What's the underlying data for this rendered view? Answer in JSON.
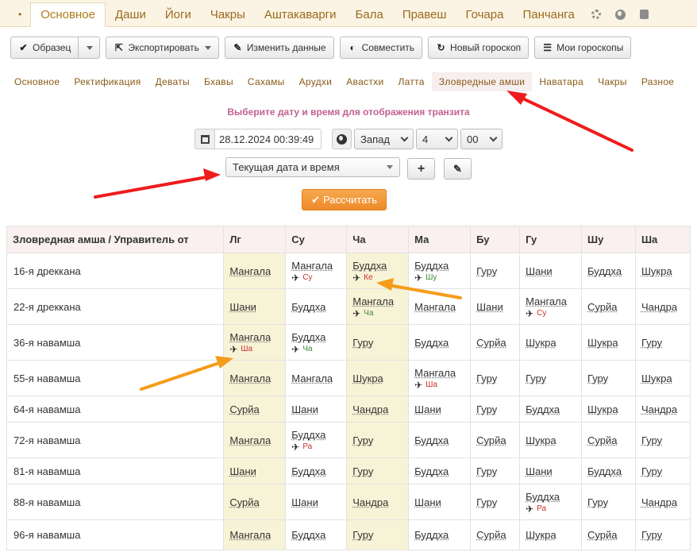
{
  "top_tabs": [
    {
      "label": "•",
      "active": false
    },
    {
      "label": "Основное",
      "active": true
    },
    {
      "label": "Даши",
      "active": false
    },
    {
      "label": "Йоги",
      "active": false
    },
    {
      "label": "Чакры",
      "active": false
    },
    {
      "label": "Аштакаварги",
      "active": false
    },
    {
      "label": "Бала",
      "active": false
    },
    {
      "label": "Правеш",
      "active": false
    },
    {
      "label": "Гочара",
      "active": false
    },
    {
      "label": "Панчанга",
      "active": false
    }
  ],
  "top_icons": [
    "gear-icon",
    "globe-icon",
    "book-icon"
  ],
  "toolbar": {
    "sample": "Образец",
    "export": "Экспортировать",
    "edit": "Изменить данные",
    "combine": "Совместить",
    "new_horoscope": "Новый гороскоп",
    "my_horoscopes": "Мои гороскопы"
  },
  "sub_tabs": [
    {
      "label": "Основное",
      "active": false
    },
    {
      "label": "Ректификация",
      "active": false
    },
    {
      "label": "Деваты",
      "active": false
    },
    {
      "label": "Бхавы",
      "active": false
    },
    {
      "label": "Сахамы",
      "active": false
    },
    {
      "label": "Арудхи",
      "active": false
    },
    {
      "label": "Авастхи",
      "active": false
    },
    {
      "label": "Латта",
      "active": false
    },
    {
      "label": "Зловредные амши",
      "active": true
    },
    {
      "label": "Наватара",
      "active": false
    },
    {
      "label": "Чакры",
      "active": false
    },
    {
      "label": "Разное",
      "active": false
    }
  ],
  "transit": {
    "prompt": "Выберите дату и время для отображения транзита",
    "datetime_value": "28.12.2024 00:39:49",
    "direction": "Запад",
    "hours": "4",
    "minutes": "00",
    "mode_select": "Текущая дата и время",
    "calculate": "Рассчитать"
  },
  "table": {
    "corner_header": "Зловредная амша / Управитель от",
    "columns": [
      "Лг",
      "Су",
      "Ча",
      "Ма",
      "Бу",
      "Гу",
      "Шу",
      "Ша"
    ],
    "highlight_columns": [
      0,
      2
    ],
    "rows": [
      {
        "label": "16-я дреккана",
        "cells": [
          {
            "lord": "Мангала"
          },
          {
            "lord": "Мангала",
            "with": "Су",
            "tone": "bad"
          },
          {
            "lord": "Буддха",
            "with": "Ке",
            "tone": "bad"
          },
          {
            "lord": "Буддха",
            "with": "Шу",
            "tone": "good"
          },
          {
            "lord": "Гуру"
          },
          {
            "lord": "Шани"
          },
          {
            "lord": "Буддха"
          },
          {
            "lord": "Шукра"
          }
        ]
      },
      {
        "label": "22-я дреккана",
        "cells": [
          {
            "lord": "Шани"
          },
          {
            "lord": "Буддха"
          },
          {
            "lord": "Мангала",
            "with": "Ча",
            "tone": "good"
          },
          {
            "lord": "Мангала"
          },
          {
            "lord": "Шани"
          },
          {
            "lord": "Мангала",
            "with": "Су",
            "tone": "bad"
          },
          {
            "lord": "Сурйа"
          },
          {
            "lord": "Чандра"
          }
        ]
      },
      {
        "label": "36-я навамша",
        "cells": [
          {
            "lord": "Мангала",
            "with": "Ша",
            "tone": "bad"
          },
          {
            "lord": "Буддха",
            "with": "Ча",
            "tone": "good"
          },
          {
            "lord": "Гуру"
          },
          {
            "lord": "Буддха"
          },
          {
            "lord": "Сурйа"
          },
          {
            "lord": "Шукра"
          },
          {
            "lord": "Шукра"
          },
          {
            "lord": "Гуру"
          }
        ]
      },
      {
        "label": "55-я навамша",
        "cells": [
          {
            "lord": "Мангала"
          },
          {
            "lord": "Мангала"
          },
          {
            "lord": "Шукра"
          },
          {
            "lord": "Мангала",
            "with": "Ша",
            "tone": "bad"
          },
          {
            "lord": "Гуру"
          },
          {
            "lord": "Гуру"
          },
          {
            "lord": "Гуру"
          },
          {
            "lord": "Шукра"
          }
        ]
      },
      {
        "label": "64-я навамша",
        "cells": [
          {
            "lord": "Сурйа"
          },
          {
            "lord": "Шани"
          },
          {
            "lord": "Чандра"
          },
          {
            "lord": "Шани"
          },
          {
            "lord": "Гуру"
          },
          {
            "lord": "Буддха"
          },
          {
            "lord": "Шукра"
          },
          {
            "lord": "Чандра"
          }
        ]
      },
      {
        "label": "72-я навамша",
        "cells": [
          {
            "lord": "Мангала"
          },
          {
            "lord": "Буддха",
            "with": "Ра",
            "tone": "bad"
          },
          {
            "lord": "Гуру"
          },
          {
            "lord": "Буддха"
          },
          {
            "lord": "Сурйа"
          },
          {
            "lord": "Шукра"
          },
          {
            "lord": "Сурйа"
          },
          {
            "lord": "Гуру"
          }
        ]
      },
      {
        "label": "81-я навамша",
        "cells": [
          {
            "lord": "Шани"
          },
          {
            "lord": "Буддха"
          },
          {
            "lord": "Гуру"
          },
          {
            "lord": "Буддха"
          },
          {
            "lord": "Гуру"
          },
          {
            "lord": "Шани"
          },
          {
            "lord": "Буддха"
          },
          {
            "lord": "Гуру"
          }
        ]
      },
      {
        "label": "88-я навамша",
        "cells": [
          {
            "lord": "Сурйа"
          },
          {
            "lord": "Шани"
          },
          {
            "lord": "Чандра"
          },
          {
            "lord": "Шани"
          },
          {
            "lord": "Гуру"
          },
          {
            "lord": "Буддха",
            "with": "Ра",
            "tone": "bad"
          },
          {
            "lord": "Гуру"
          },
          {
            "lord": "Чандра"
          }
        ]
      },
      {
        "label": "96-я навамша",
        "cells": [
          {
            "lord": "Мангала"
          },
          {
            "lord": "Буддха"
          },
          {
            "lord": "Гуру"
          },
          {
            "lord": "Буддха"
          },
          {
            "lord": "Сурйа"
          },
          {
            "lord": "Шукра"
          },
          {
            "lord": "Сурйа"
          },
          {
            "lord": "Гуру"
          }
        ]
      }
    ]
  },
  "colors": {
    "tone_bad": "#c9302c",
    "tone_good": "#3c8a3c",
    "annotation_red": "#ee1c1c",
    "annotation_orange": "#f59c1a",
    "highlight_column": "#f7f3d6"
  }
}
